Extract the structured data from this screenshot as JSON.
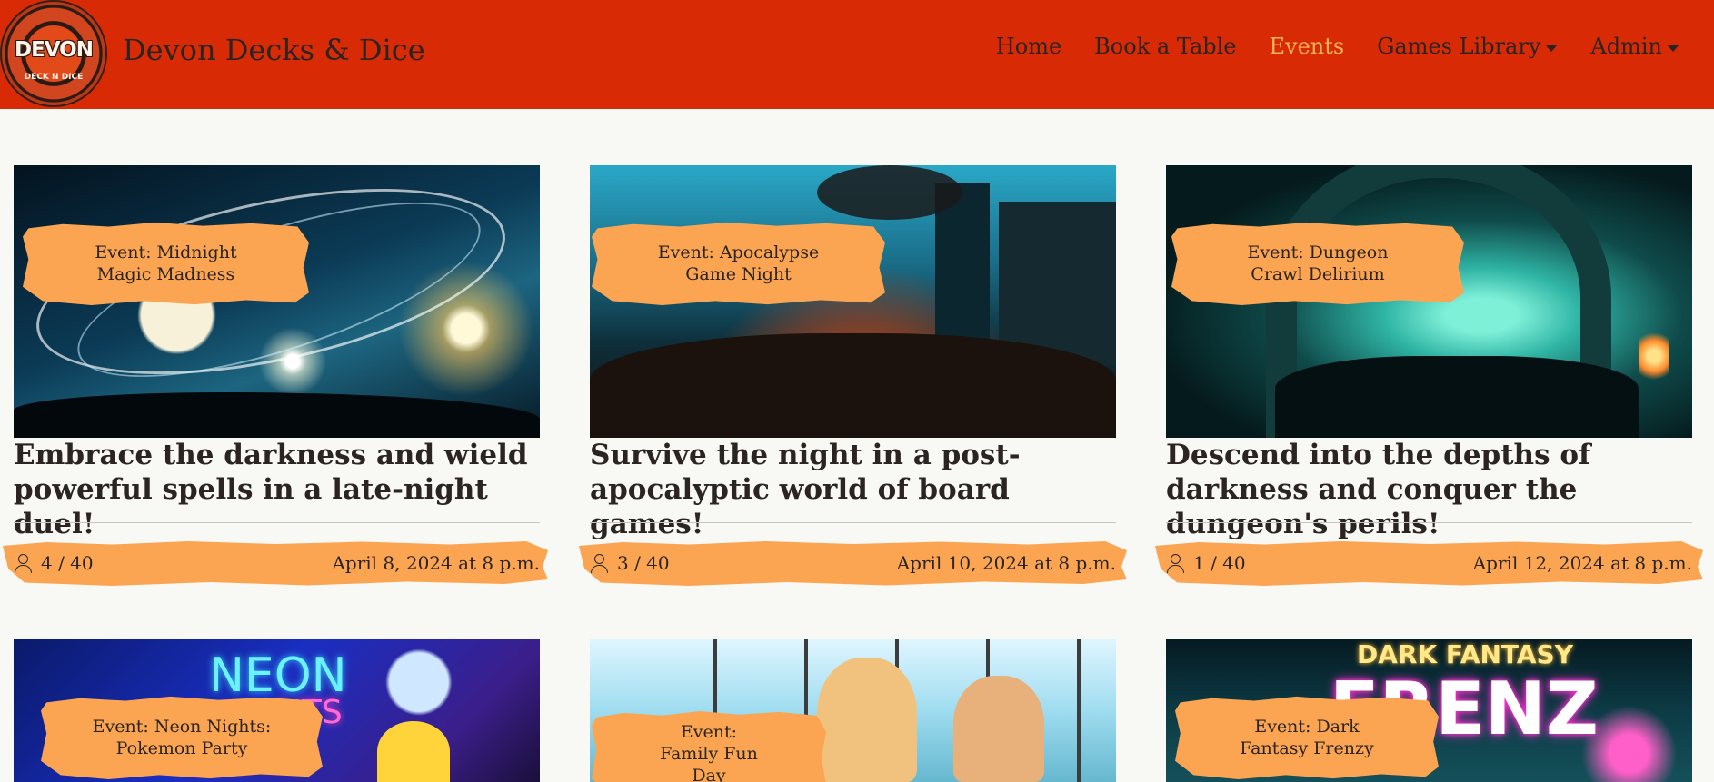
{
  "brand": {
    "logo_text": "DEVON",
    "logo_sub": "DECK N DICE",
    "name": "Devon Decks & Dice"
  },
  "nav": {
    "home": "Home",
    "book": "Book a Table",
    "events": "Events",
    "games": "Games Library",
    "admin": "Admin"
  },
  "colors": {
    "navbar": "#d82a05",
    "accent_orange": "#fba552",
    "active_link": "#f6b35a",
    "background": "#f8f8f5"
  },
  "events": [
    {
      "tag_line1": "Event: Midnight",
      "tag_line2": "Magic Madness",
      "title": "Embrace the darkness and wield powerful spells in a late-night duel!",
      "attendance": "4 / 40",
      "date": "April 8, 2024 at 8 p.m."
    },
    {
      "tag_line1": "Event: Apocalypse",
      "tag_line2": "Game Night",
      "title": "Survive the night in a post-apocalyptic world of board games!",
      "attendance": "3 / 40",
      "date": "April 10, 2024 at 8 p.m."
    },
    {
      "tag_line1": "Event: Dungeon",
      "tag_line2": "Crawl Delirium",
      "title": "Descend into the depths of darkness and conquer the dungeon's perils!",
      "attendance": "1 / 40",
      "date": "April 12, 2024 at 8 p.m."
    },
    {
      "tag_line1": "Event: Neon Nights:",
      "tag_line2": "Pokemon Party",
      "img_text1": "NEON",
      "img_text2": "NTS"
    },
    {
      "tag_line1": "Event:",
      "tag_line2": "Family Fun",
      "tag_line3": "Day"
    },
    {
      "tag_line1": "Event: Dark",
      "tag_line2": "Fantasy Frenzy",
      "img_text1": "DARK FANTASY",
      "img_text2": "FRENZ"
    }
  ]
}
